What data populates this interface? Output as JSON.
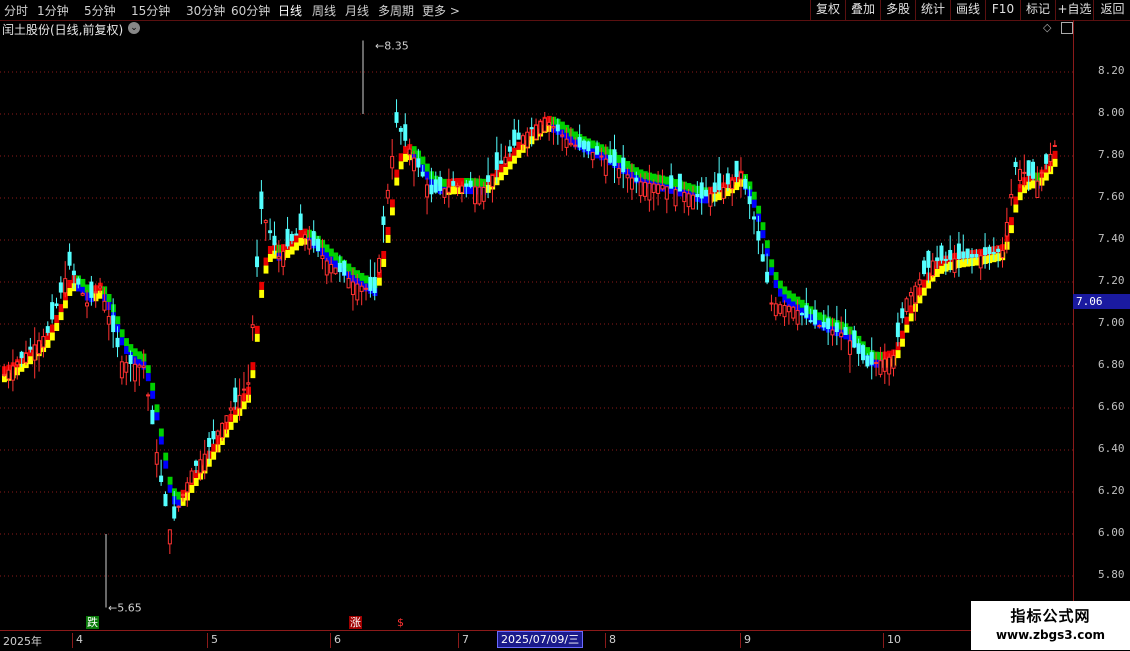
{
  "toolbar": {
    "timeframes": [
      "分时",
      "1分钟",
      "5分钟",
      "15分钟",
      "30分钟",
      "60分钟",
      "日线",
      "周线",
      "月线",
      "多周期",
      "更多 >"
    ],
    "active_timeframe": "日线",
    "right_buttons": [
      "复权",
      "叠加",
      "多股",
      "统计",
      "画线",
      "F10",
      "标记",
      "+自选",
      "返回"
    ]
  },
  "chart_title": "闰土股份(日线,前复权)",
  "price_axis": {
    "labels": [
      "8.20",
      "8.00",
      "7.80",
      "7.60",
      "7.40",
      "7.20",
      "7.00",
      "6.80",
      "6.60",
      "6.40",
      "6.20",
      "6.00",
      "5.80"
    ],
    "current_price": "7.06"
  },
  "date_axis": {
    "labels": [
      "2025年",
      "4",
      "5",
      "6",
      "7",
      "8",
      "9",
      "10"
    ],
    "cursor_date": "2025/07/09/三"
  },
  "annotations": {
    "high_label": "8.35",
    "low_label": "5.65"
  },
  "signals": {
    "fall": "跌",
    "rise": "涨",
    "dollar": "$"
  },
  "colors": {
    "bg": "#000000",
    "up": "#ff3232",
    "down": "#54ffff",
    "band_up_red": "#e60000",
    "band_up_yellow": "#ffff00",
    "band_down_green": "#00d000",
    "band_down_blue": "#0000ff",
    "grid": "#8b1a1a"
  },
  "watermark": {
    "title": "指标公式网",
    "url": "www.zbgs3.com"
  },
  "chart_data": {
    "type": "candlestick",
    "ylim": [
      5.6,
      8.4
    ],
    "anchors": [
      [
        0,
        6.76
      ],
      [
        10,
        6.96
      ],
      [
        15,
        7.28
      ],
      [
        19,
        7.1
      ],
      [
        22,
        7.18
      ],
      [
        27,
        6.82
      ],
      [
        32,
        6.8
      ],
      [
        36,
        6.25
      ],
      [
        38,
        6.02
      ],
      [
        43,
        6.3
      ],
      [
        46,
        6.38
      ],
      [
        52,
        6.6
      ],
      [
        56,
        6.72
      ],
      [
        59,
        7.55
      ],
      [
        63,
        7.32
      ],
      [
        68,
        7.45
      ],
      [
        74,
        7.3
      ],
      [
        80,
        7.2
      ],
      [
        85,
        7.15
      ],
      [
        90,
        7.96
      ],
      [
        98,
        7.62
      ],
      [
        103,
        7.66
      ],
      [
        110,
        7.65
      ],
      [
        118,
        7.88
      ],
      [
        124,
        7.98
      ],
      [
        130,
        7.86
      ],
      [
        137,
        7.8
      ],
      [
        145,
        7.68
      ],
      [
        151,
        7.66
      ],
      [
        160,
        7.6
      ],
      [
        165,
        7.65
      ],
      [
        169,
        7.72
      ],
      [
        172,
        7.5
      ],
      [
        176,
        7.1
      ],
      [
        181,
        7.08
      ],
      [
        186,
        7.0
      ],
      [
        193,
        6.95
      ],
      [
        198,
        6.8
      ],
      [
        204,
        6.85
      ],
      [
        207,
        7.12
      ],
      [
        213,
        7.3
      ],
      [
        223,
        7.32
      ],
      [
        229,
        7.35
      ],
      [
        232,
        7.75
      ],
      [
        237,
        7.68
      ],
      [
        241,
        7.85
      ]
    ]
  }
}
